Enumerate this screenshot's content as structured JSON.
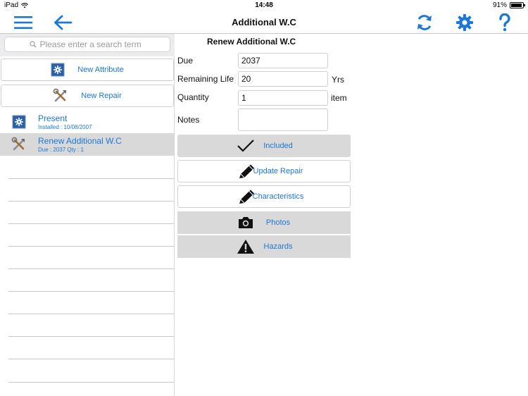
{
  "status_bar": {
    "device": "iPad",
    "time": "14:48",
    "battery": "91%"
  },
  "navbar": {
    "title": "Additional W.C",
    "icons": [
      "menu-icon",
      "back-arrow-icon",
      "refresh-icon",
      "gear-icon",
      "help-icon"
    ]
  },
  "left_panel": {
    "search_placeholder": "Please enter a search term",
    "new_attribute_label": "New Attribute",
    "new_repair_label": "New Repair",
    "items": [
      {
        "title": "Present",
        "subtitle": "Installed : 10/08/2007",
        "selected": false
      },
      {
        "title": "Renew Additional W.C",
        "subtitle": "Due : 2037   Qty : 1",
        "selected": true
      }
    ]
  },
  "right_panel": {
    "title": "Renew Additional W.C",
    "due_label": "Due",
    "due_value": "2037",
    "remaining_life_label": "Remaining Life",
    "remaining_life_value": "20",
    "remaining_life_unit": "Yrs",
    "quantity_label": "Quantity",
    "quantity_value": "1",
    "quantity_unit": "item",
    "notes_label": "Notes",
    "notes_value": "",
    "buttons": {
      "included": "Included",
      "update_repair": "Update Repair",
      "characteristics": "Characteristics",
      "photos": "Photos",
      "hazards": "Hazards"
    }
  },
  "colors": {
    "accent": "#1b78d6",
    "selected_row": "#d9d9d9",
    "separator": "#c8c8cc"
  }
}
